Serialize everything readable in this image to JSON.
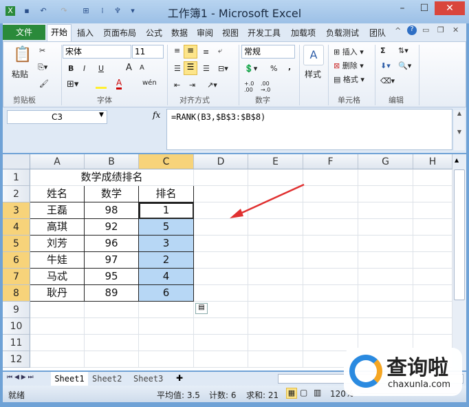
{
  "window": {
    "title": "工作簿1 - Microsoft Excel"
  },
  "ribbon_tabs": [
    "文件",
    "开始",
    "插入",
    "页面布局",
    "公式",
    "数据",
    "审阅",
    "视图",
    "开发工具",
    "加载项",
    "负载测试",
    "团队"
  ],
  "ribbon": {
    "clipboard": {
      "paste": "粘贴",
      "group": "剪贴板"
    },
    "font": {
      "name": "宋体",
      "size": "11",
      "bold": "B",
      "italic": "I",
      "underline": "U",
      "grow": "A",
      "shrink": "A",
      "group": "字体",
      "wen": "wén"
    },
    "alignment": {
      "group": "对齐方式"
    },
    "number": {
      "format": "常规",
      "percent": "%",
      "comma": ",",
      "group": "数字",
      "inc": "+.0 .00",
      "dec": ".00 →.0"
    },
    "styles": {
      "label": "样式"
    },
    "cells": {
      "insert": "插入",
      "delete": "删除",
      "format": "格式",
      "group": "单元格"
    },
    "editing": {
      "sum": "Σ",
      "group": "编辑"
    }
  },
  "formula_bar": {
    "name_box": "C3",
    "fx": "fx",
    "formula": "=RANK(B3,$B$3:$B$8)"
  },
  "columns": [
    "A",
    "B",
    "C",
    "D",
    "E",
    "F",
    "G",
    "H"
  ],
  "rows": [
    "1",
    "2",
    "3",
    "4",
    "5",
    "6",
    "7",
    "8",
    "9",
    "10",
    "11",
    "12"
  ],
  "sheet": {
    "title": "数学成绩排名",
    "headers": [
      "姓名",
      "数学",
      "排名"
    ],
    "data": [
      [
        "王磊",
        "98",
        "1"
      ],
      [
        "高琪",
        "92",
        "5"
      ],
      [
        "刘芳",
        "96",
        "3"
      ],
      [
        "牛娃",
        "97",
        "2"
      ],
      [
        "马忒",
        "95",
        "4"
      ],
      [
        "耿丹",
        "89",
        "6"
      ]
    ]
  },
  "sheet_tabs": [
    "Sheet1",
    "Sheet2",
    "Sheet3"
  ],
  "status": {
    "ready": "就绪",
    "average": "平均值: 3.5",
    "count": "计数: 6",
    "sum": "求和: 21",
    "zoom": "120%"
  },
  "watermark": {
    "name": "查询啦",
    "url": "chaxunla.com"
  },
  "colors": {
    "selection": "#b7d7f5",
    "file_tab": "#2a8a3a",
    "arrow": "#e03030",
    "header_selected": "#f7d37a"
  }
}
